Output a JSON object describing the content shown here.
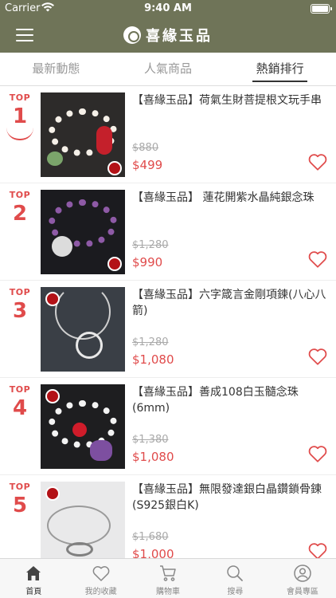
{
  "status_bar": {
    "carrier": "Carrier",
    "time": "9:40 AM"
  },
  "header": {
    "brand": "喜緣玉品",
    "icons": {
      "menu": "hamburger-icon",
      "logo": "seal-icon"
    }
  },
  "tabs": [
    {
      "label": "最新動態",
      "active": false
    },
    {
      "label": "人氣商品",
      "active": false
    },
    {
      "label": "熱銷排行",
      "active": true
    }
  ],
  "products": [
    {
      "rank_label": "TOP",
      "rank": "1",
      "title": "【喜緣玉品】荷氣生財菩提根文玩手串",
      "old_price": "$880",
      "price": "$499"
    },
    {
      "rank_label": "TOP",
      "rank": "2",
      "title": "【喜緣玉品】 蓮花開紫水晶純銀念珠",
      "old_price": "$1,280",
      "price": "$990"
    },
    {
      "rank_label": "TOP",
      "rank": "3",
      "title": "【喜緣玉品】六字箴言金剛項鍊(八心八箭)",
      "old_price": "$1,280",
      "price": "$1,080"
    },
    {
      "rank_label": "TOP",
      "rank": "4",
      "title": "【喜緣玉品】善成108白玉髓念珠(6mm)",
      "old_price": "$1,380",
      "price": "$1,080"
    },
    {
      "rank_label": "TOP",
      "rank": "5",
      "title": "【喜緣玉品】無限發達銀白晶鑽鎖骨鍊(S925銀白K)",
      "old_price": "$1,680",
      "price": "$1,000"
    }
  ],
  "tab_bar": [
    {
      "label": "首頁",
      "icon": "home-icon",
      "active": true
    },
    {
      "label": "我的收藏",
      "icon": "heart-icon",
      "active": false
    },
    {
      "label": "購物車",
      "icon": "cart-icon",
      "active": false
    },
    {
      "label": "搜尋",
      "icon": "search-icon",
      "active": false
    },
    {
      "label": "會員專區",
      "icon": "user-icon",
      "active": false
    }
  ],
  "colors": {
    "header_bg": "#6f7458",
    "accent_red": "#e04b4b"
  }
}
